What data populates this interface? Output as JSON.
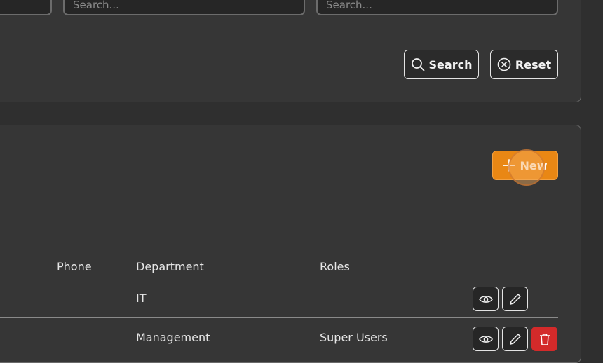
{
  "filters": {
    "search_placeholder_1": "Search...",
    "search_placeholder_2": "Search...",
    "search_button": "Search",
    "reset_button": "Reset"
  },
  "list": {
    "new_button": "New",
    "columns": [
      "Phone",
      "Department",
      "Roles"
    ],
    "rows": [
      {
        "phone": "",
        "department": "IT",
        "roles": ""
      },
      {
        "phone": "",
        "department": "Management",
        "roles": "Super Users"
      }
    ]
  },
  "colors": {
    "primary": "#e98714",
    "danger": "#d32a2a",
    "background": "#2f2f2f",
    "panel": "#363636"
  },
  "icons": {
    "search": "search-icon",
    "reset": "close-circle-icon",
    "new": "plus-icon",
    "view": "eye-icon",
    "edit": "pencil-icon",
    "delete": "trash-icon"
  }
}
